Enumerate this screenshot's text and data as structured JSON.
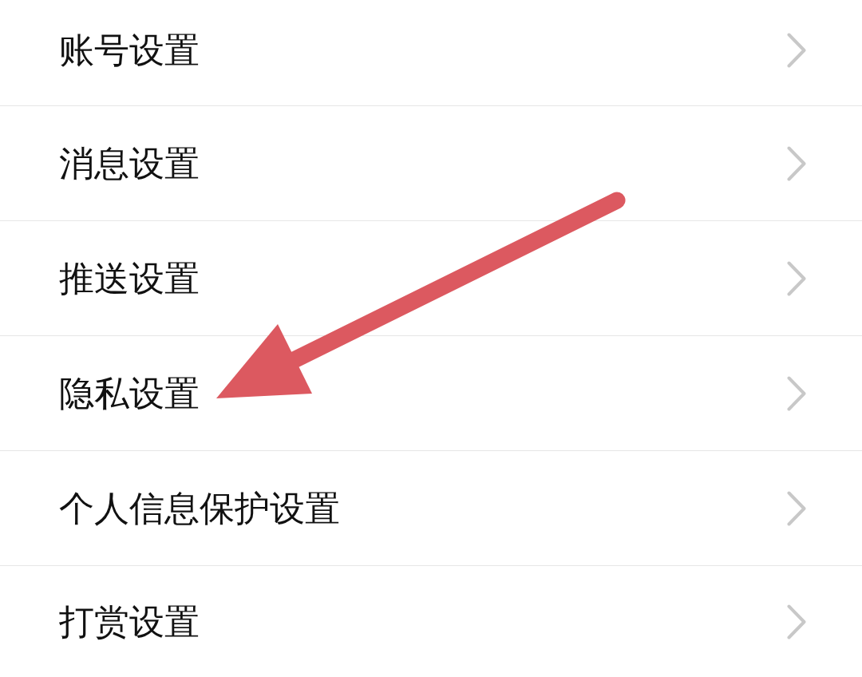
{
  "settings": [
    {
      "label": "账号设置"
    },
    {
      "label": "消息设置"
    },
    {
      "label": "推送设置"
    },
    {
      "label": "隐私设置"
    },
    {
      "label": "个人信息保护设置"
    },
    {
      "label": "打赏设置"
    }
  ],
  "annotations": [
    {
      "kind": "arrow"
    }
  ]
}
